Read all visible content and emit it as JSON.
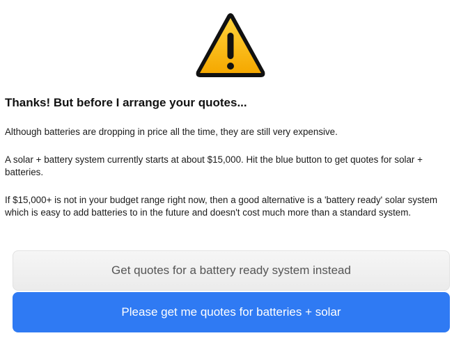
{
  "warning": {
    "icon": "warning-triangle-icon",
    "colors": {
      "fill": "#f7b500",
      "border": "#111111"
    }
  },
  "heading": "Thanks! But before I arrange your quotes...",
  "paragraphs": [
    "Although batteries are dropping in price all the time, they are still very expensive.",
    "A solar + battery system currently starts at about $15,000. Hit the blue button to get quotes for solar + batteries.",
    "If $15,000+ is not in your budget range right now, then a good alternative is a 'battery ready' solar system which is easy to add batteries to in the future and doesn't cost much more than a standard system."
  ],
  "buttons": {
    "secondary_label": "Get quotes for a battery ready system instead",
    "primary_label": "Please get me quotes for batteries + solar"
  },
  "colors": {
    "primary": "#2f7af3",
    "secondary_bg": "#efefef",
    "secondary_text": "#555555"
  }
}
